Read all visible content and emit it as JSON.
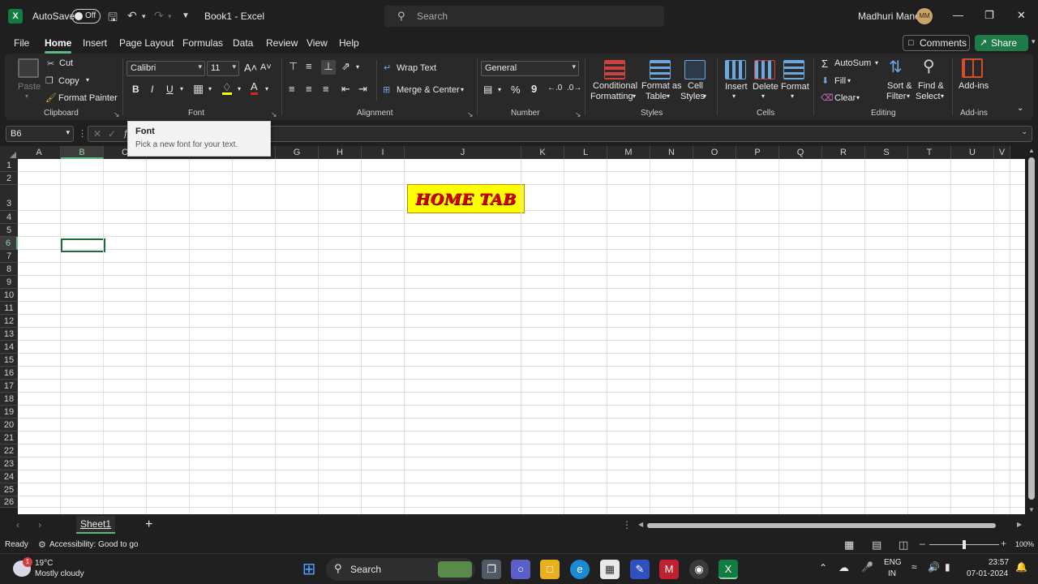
{
  "titlebar": {
    "autosave_label": "AutoSave",
    "autosave_state": "Off",
    "doc_title": "Book1  -  Excel",
    "search_placeholder": "Search",
    "user_name": "Madhuri Mane",
    "user_initials": "MM"
  },
  "menu": {
    "tabs": [
      "File",
      "Home",
      "Insert",
      "Page Layout",
      "Formulas",
      "Data",
      "Review",
      "View",
      "Help"
    ],
    "active": "Home",
    "comments_label": "Comments",
    "share_label": "Share"
  },
  "ribbon": {
    "clipboard": {
      "paste": "Paste",
      "cut": "Cut",
      "copy": "Copy",
      "format_painter": "Format Painter",
      "label": "Clipboard"
    },
    "font": {
      "name": "Calibri",
      "size": "11",
      "grow": "A˄",
      "shrink": "A˅",
      "bold": "B",
      "italic": "I",
      "underline": "U",
      "label": "Font"
    },
    "alignment": {
      "wrap_text": "Wrap Text",
      "merge_center": "Merge & Center",
      "label": "Alignment"
    },
    "number": {
      "format": "General",
      "percent": "%",
      "comma": "9",
      "label": "Number"
    },
    "styles": {
      "conditional_1": "Conditional",
      "conditional_2": "Formatting",
      "format_table_1": "Format as",
      "format_table_2": "Table",
      "cell_styles_1": "Cell",
      "cell_styles_2": "Styles",
      "label": "Styles"
    },
    "cells": {
      "insert": "Insert",
      "delete": "Delete",
      "format": "Format",
      "label": "Cells"
    },
    "editing": {
      "autosum": "AutoSum",
      "fill": "Fill",
      "clear": "Clear",
      "sort_1": "Sort &",
      "sort_2": "Filter",
      "find_1": "Find &",
      "find_2": "Select",
      "label": "Editing"
    },
    "addins": {
      "addins": "Add-ins",
      "label": "Add-ins"
    }
  },
  "formula_bar": {
    "name_box": "B6",
    "fx": "fx",
    "value": ""
  },
  "tooltip": {
    "title": "Font",
    "desc": "Pick a new font for your text."
  },
  "grid": {
    "columns": [
      "A",
      "B",
      "C",
      "D",
      "E",
      "F",
      "G",
      "H",
      "I",
      "J",
      "K",
      "L",
      "M",
      "N",
      "O",
      "P",
      "Q",
      "R",
      "S",
      "T",
      "U",
      "V"
    ],
    "rows": [
      "1",
      "2",
      "3",
      "4",
      "5",
      "6",
      "7",
      "8",
      "9",
      "10",
      "11",
      "12",
      "13",
      "14",
      "15",
      "16",
      "17",
      "18",
      "19",
      "20",
      "21",
      "22",
      "23",
      "24",
      "25",
      "26"
    ],
    "selected_cell": "B6",
    "cell_J3": "HOME TAB"
  },
  "sheets": {
    "active": "Sheet1"
  },
  "status": {
    "ready": "Ready",
    "accessibility": "Accessibility: Good to go",
    "zoom": "100%"
  },
  "taskbar": {
    "weather_temp": "19°C",
    "weather_desc": "Mostly cloudy",
    "weather_badge": "1",
    "search": "Search",
    "lang_1": "ENG",
    "lang_2": "IN",
    "time": "23:57",
    "date": "07-01-2024"
  },
  "colors": {
    "accent_green": "#5fb97e",
    "excel_green": "#107c41",
    "cell_fill": "#ffff00",
    "cell_text": "#d40000"
  }
}
